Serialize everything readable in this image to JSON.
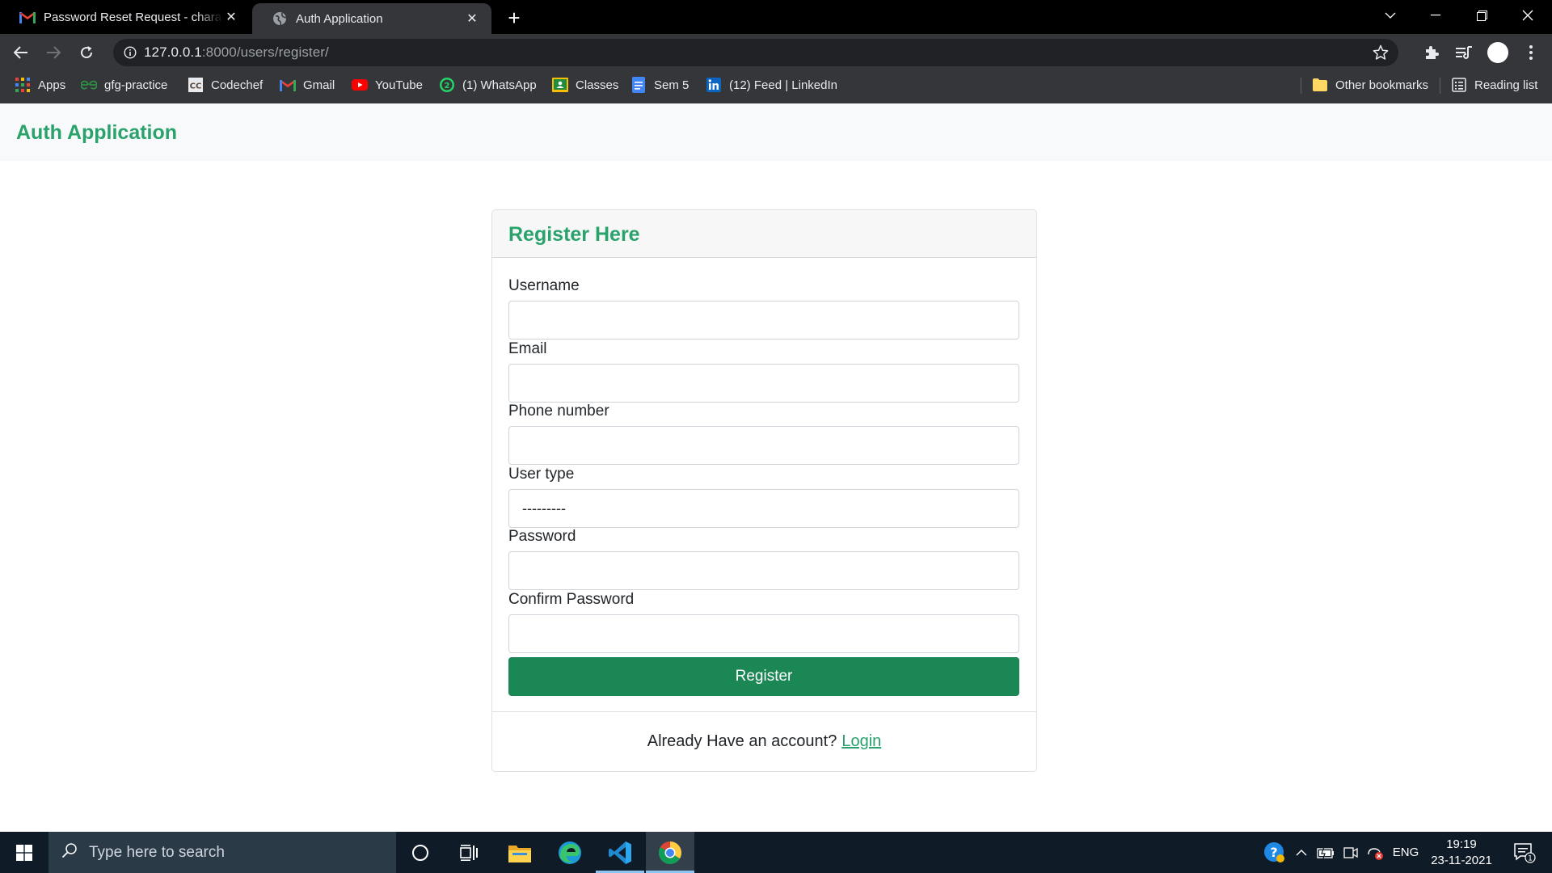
{
  "browser": {
    "tabs": [
      {
        "title": "Password Reset Request - charan",
        "icon": "gmail-icon",
        "active": false
      },
      {
        "title": "Auth Application",
        "icon": "globe-icon",
        "active": true
      }
    ],
    "url": {
      "host": "127.0.0.1",
      "path": ":8000/users/register/"
    },
    "bookmarks": [
      {
        "label": "Apps",
        "icon": "apps-grid-icon"
      },
      {
        "label": "gfg-practice",
        "icon": "gfg-icon"
      },
      {
        "label": "Codechef",
        "icon": "codechef-icon"
      },
      {
        "label": "Gmail",
        "icon": "gmail-icon"
      },
      {
        "label": "YouTube",
        "icon": "youtube-icon"
      },
      {
        "label": "(1) WhatsApp",
        "icon": "whatsapp-icon"
      },
      {
        "label": "Classes",
        "icon": "classroom-icon"
      },
      {
        "label": "Sem 5",
        "icon": "docs-icon"
      },
      {
        "label": "(12) Feed | LinkedIn",
        "icon": "linkedin-icon"
      }
    ],
    "other_bookmarks": "Other bookmarks",
    "reading_list": "Reading list"
  },
  "page": {
    "brand": "Auth Application",
    "card": {
      "title": "Register Here",
      "fields": [
        {
          "label": "Username",
          "value": ""
        },
        {
          "label": "Email",
          "value": ""
        },
        {
          "label": "Phone number",
          "value": ""
        },
        {
          "label": "User type",
          "value": "---------"
        },
        {
          "label": "Password",
          "value": ""
        },
        {
          "label": "Confirm Password",
          "value": ""
        }
      ],
      "submit_label": "Register",
      "footer_text": "Already Have an account?",
      "footer_link": "Login"
    }
  },
  "taskbar": {
    "search_placeholder": "Type here to search",
    "language": "ENG",
    "time": "19:19",
    "date": "23-11-2021",
    "notification_count": "1"
  },
  "colors": {
    "brand_green": "#2aa26b",
    "button_green": "#1b8754",
    "browser_chrome": "#35363a"
  }
}
